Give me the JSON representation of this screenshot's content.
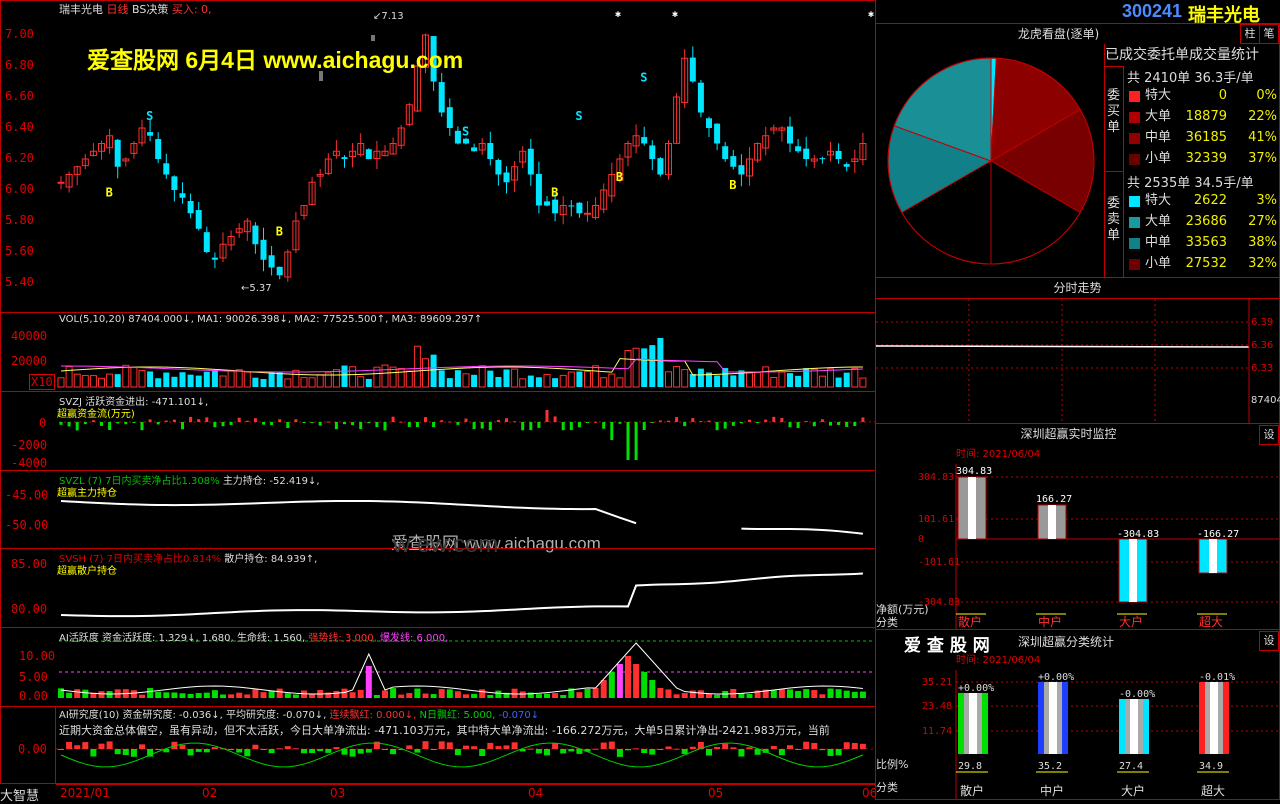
{
  "header": {
    "stock_name": "瑞丰光电",
    "period": "日线",
    "indicator": "BS决策",
    "buy_label": "买入: 0,",
    "watermark": "爱查股网   6月4日   www.aichagu.com",
    "center_watermark": "爱查股网     www.aichagu.com",
    "center_watermark2": "w                              ew.com",
    "high_mark": "7.13",
    "low_mark": "5.37"
  },
  "main_chart": {
    "yticks": [
      "7.00",
      "6.80",
      "6.60",
      "6.40",
      "6.20",
      "6.00",
      "5.80",
      "5.60",
      "5.40"
    ]
  },
  "vol": {
    "legend": "VOL(5,10,20) 87404.000↓, MA1: 90026.398↓, MA2: 77525.500↑, MA3: 89609.297↑",
    "yticks": [
      "40000",
      "20000"
    ],
    "unit": "X10"
  },
  "svzj": {
    "legend1": "SVZJ  活跃资金进出: -471.101↓,",
    "legend2": "超赢资金流(万元)",
    "yticks": [
      "0",
      "-2000",
      "-4000"
    ]
  },
  "svzl": {
    "legend_a": "SVZL (7) 7日内买卖净占比1.308%",
    "legend_b": "主力持仓: -52.419↓,",
    "legend2": "超赢主力持仓",
    "yticks": [
      "-45.00",
      "-50.00"
    ]
  },
  "svsh": {
    "legend_a": "SVSH (7) 7日内买卖净占比0.814%",
    "legend_b": "散户持仓: 84.939↑,",
    "legend2": "超赢散户持仓",
    "yticks": [
      "85.00",
      "80.00"
    ]
  },
  "ai_active": {
    "legend_a": "AI活跃度 资金活跃度: 1.329↓, 1.680, 生命线: 1.560,",
    "legend_b": "强势线: 3.000,",
    "legend_c": "爆发线: 6.000,",
    "yticks": [
      "10.00",
      "5.00",
      "0.00"
    ]
  },
  "ai_research": {
    "legend_a": "AI研究度(10) 资金研究度: -0.036↓, 平均研究度: -0.070↓,",
    "legend_b": "连续飘红: 0.000↓,",
    "legend_c": "N日飘红: 5.000,",
    "legend_d": "-0.070↓",
    "text": "近期大资金总体偏空，虽有异动，但不太活跃，今日大单净流出: -471.103万元，其中特大单净流出: -166.272万元，大单5日累计净出-2421.983万元，当前",
    "yticks": [
      "0.00"
    ]
  },
  "left_bottom": "大智慧",
  "xaxis": [
    "2021/01",
    "02",
    "03",
    "04",
    "05",
    "06"
  ],
  "right": {
    "code": "300241",
    "name": "瑞丰光电",
    "btn1": "柱",
    "btn2": "笔",
    "pie_title": "龙虎看盘(逐单)",
    "pie_subtitle": "已成交委托单成交量统计",
    "buy_side_label": "委买单",
    "sell_side_label": "委卖单",
    "buy_total": "共 2410单 36.3手/单",
    "sell_total": "共 2535单 34.5手/单",
    "buy_rows": [
      {
        "label": "特大",
        "value": "0",
        "pct": "0%"
      },
      {
        "label": "大单",
        "value": "18879",
        "pct": "22%"
      },
      {
        "label": "中单",
        "value": "36185",
        "pct": "41%"
      },
      {
        "label": "小单",
        "value": "32339",
        "pct": "37%"
      }
    ],
    "sell_rows": [
      {
        "label": "特大",
        "value": "2622",
        "pct": "3%"
      },
      {
        "label": "大单",
        "value": "23686",
        "pct": "27%"
      },
      {
        "label": "中单",
        "value": "33563",
        "pct": "38%"
      },
      {
        "label": "小单",
        "value": "27532",
        "pct": "32%"
      }
    ],
    "colors": {
      "buy_super": "#ff2020",
      "buy_big": "#b00000",
      "buy_mid": "#900000",
      "buy_small": "#6a0000",
      "sell_super": "#00e5ff",
      "sell_big": "#1a9aa0",
      "sell_mid": "#128088",
      "sell_small": "#700000"
    },
    "intraday_title": "分时走势",
    "intraday_yticks": [
      "6.39",
      "6.36",
      "6.33"
    ],
    "intraday_vol": "87404",
    "monitor_title": "深圳超赢实时监控",
    "monitor_time": "时间: 2021/06/04",
    "monitor_btn": "设",
    "monitor_yticks": [
      "304.83",
      "101.61",
      "0",
      "-101.61",
      "-304.83"
    ],
    "monitor_ylabel": "净额(万元)",
    "monitor_xlabel": "分类",
    "monitor_cats": [
      "散户",
      "中户",
      "大户",
      "超大"
    ],
    "monitor_vals": [
      "304.83",
      "166.27",
      "-304.83",
      "-166.27"
    ],
    "class_logo": "爱 查 股 网",
    "class_title": "深圳超赢分类统计",
    "class_time": "时间: 2021/06/04",
    "class_btn": "设",
    "class_yticks": [
      "35.21",
      "23.48",
      "11.74"
    ],
    "class_ylabel": "比例%",
    "class_xlabel": "分类",
    "class_pcts": [
      "+0.00%",
      "+0.00%",
      "-0.00%",
      "-0.01%"
    ],
    "class_vals": [
      "29.8",
      "35.2",
      "27.4",
      "34.9"
    ],
    "class_cats": [
      "散户",
      "中户",
      "大户",
      "超大"
    ]
  }
}
